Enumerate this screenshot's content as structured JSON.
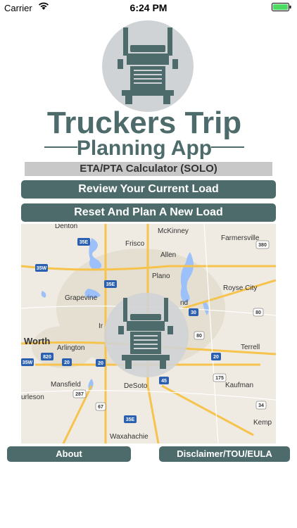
{
  "status_bar": {
    "carrier": "Carrier",
    "time": "6:24 PM"
  },
  "logo": {
    "line1": "Truckers Trip",
    "line2": "Planning App"
  },
  "subtitle": "ETA/PTA Calculator (SOLO)",
  "buttons": {
    "review": "Review Your Current Load",
    "reset": "Reset And Plan A New Load",
    "about": "About",
    "disclaimer": "Disclaimer/TOU/EULA"
  },
  "map": {
    "cities": {
      "denton": "Denton",
      "mckinney": "McKinney",
      "farmersville": "Farmersville",
      "frisco": "Frisco",
      "allen": "Allen",
      "plano": "Plano",
      "grapevine": "Grapevine",
      "royse_city": "Royse City",
      "worth": "Worth",
      "arlington": "Arlington",
      "terrell": "Terrell",
      "mansfield": "Mansfield",
      "desoto": "DeSoto",
      "kaufman": "Kaufman",
      "burleson": "urleson",
      "kemp": "Kemp",
      "waxahachie": "Waxahachie",
      "irving_partial": "Ir",
      "garland_partial": "nd"
    },
    "shields": {
      "i35e_n": "35E",
      "i35w": "35W",
      "i35e_mid": "35E",
      "i820": "820",
      "i20_w": "20",
      "i20_mid": "20",
      "i35w_s": "35W",
      "i30": "30",
      "i80": "80",
      "i20_e": "20",
      "i45": "45",
      "us175": "175",
      "us287": "287",
      "us67": "67",
      "i35e_s": "35E",
      "us380": "380",
      "us80": "80",
      "i34": "34"
    }
  },
  "colors": {
    "brand": "#4d6b6a",
    "subtitle_bg": "#c8c8c8",
    "battery": "#4cd964"
  }
}
